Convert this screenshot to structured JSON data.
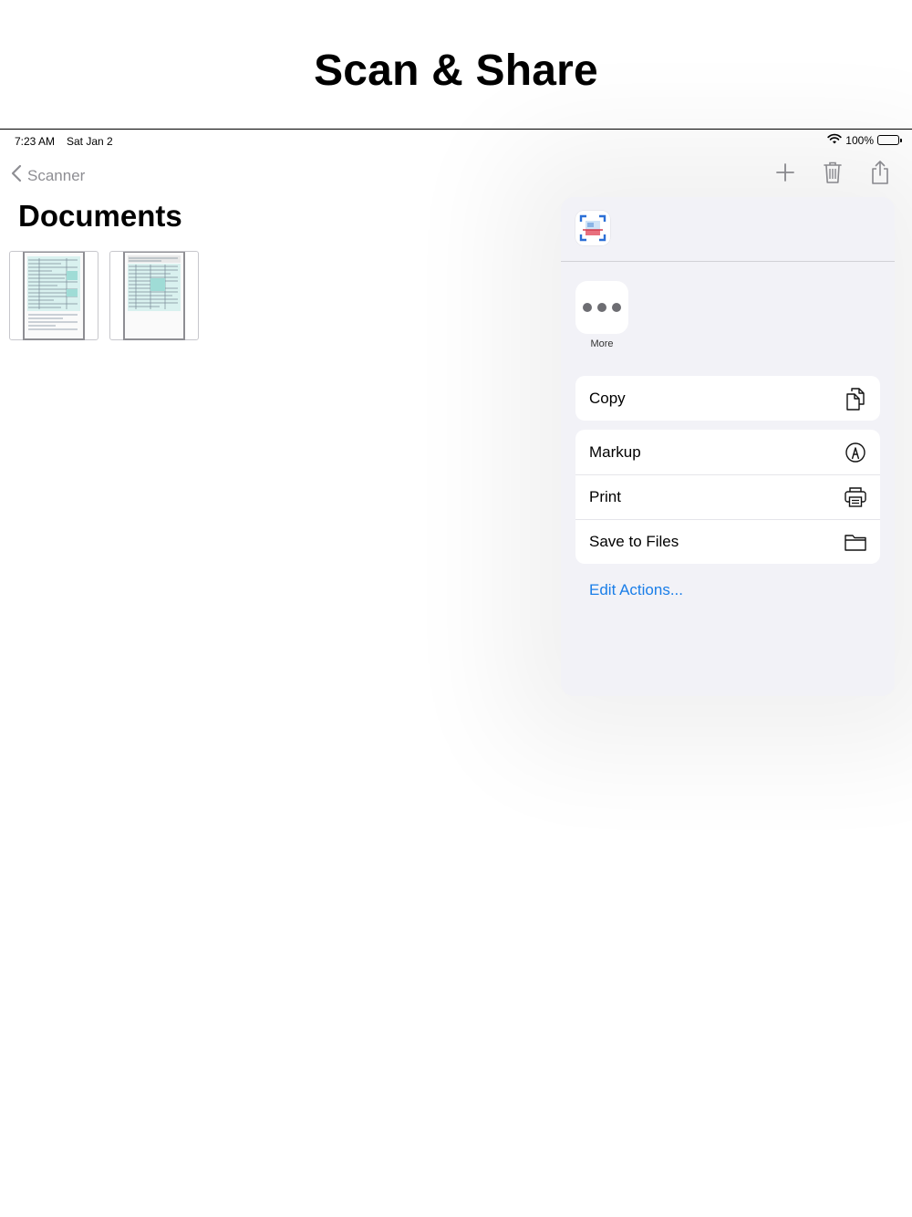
{
  "promo": {
    "title": "Scan & Share"
  },
  "status_bar": {
    "time": "7:23 AM",
    "date": "Sat Jan 2",
    "battery": "100%"
  },
  "nav": {
    "back_label": "Scanner",
    "actions": [
      "plus-icon",
      "trash-icon",
      "share-icon"
    ]
  },
  "page": {
    "title": "Documents"
  },
  "documents": [
    {
      "thumbnail": "document-thumbnail-1"
    },
    {
      "thumbnail": "document-thumbnail-2"
    }
  ],
  "share_sheet": {
    "app_icon": "scanner-app-icon",
    "more": {
      "label": "More"
    },
    "copy": {
      "label": "Copy",
      "icon": "copy-icon"
    },
    "markup": {
      "label": "Markup",
      "icon": "markup-icon"
    },
    "print": {
      "label": "Print",
      "icon": "printer-icon"
    },
    "save_to_files": {
      "label": "Save to Files",
      "icon": "folder-icon"
    },
    "edit_actions": "Edit Actions..."
  },
  "colors": {
    "link": "#1a7ee8",
    "sheet_background": "#f2f2f7",
    "nav_gray": "#8e8e93"
  }
}
